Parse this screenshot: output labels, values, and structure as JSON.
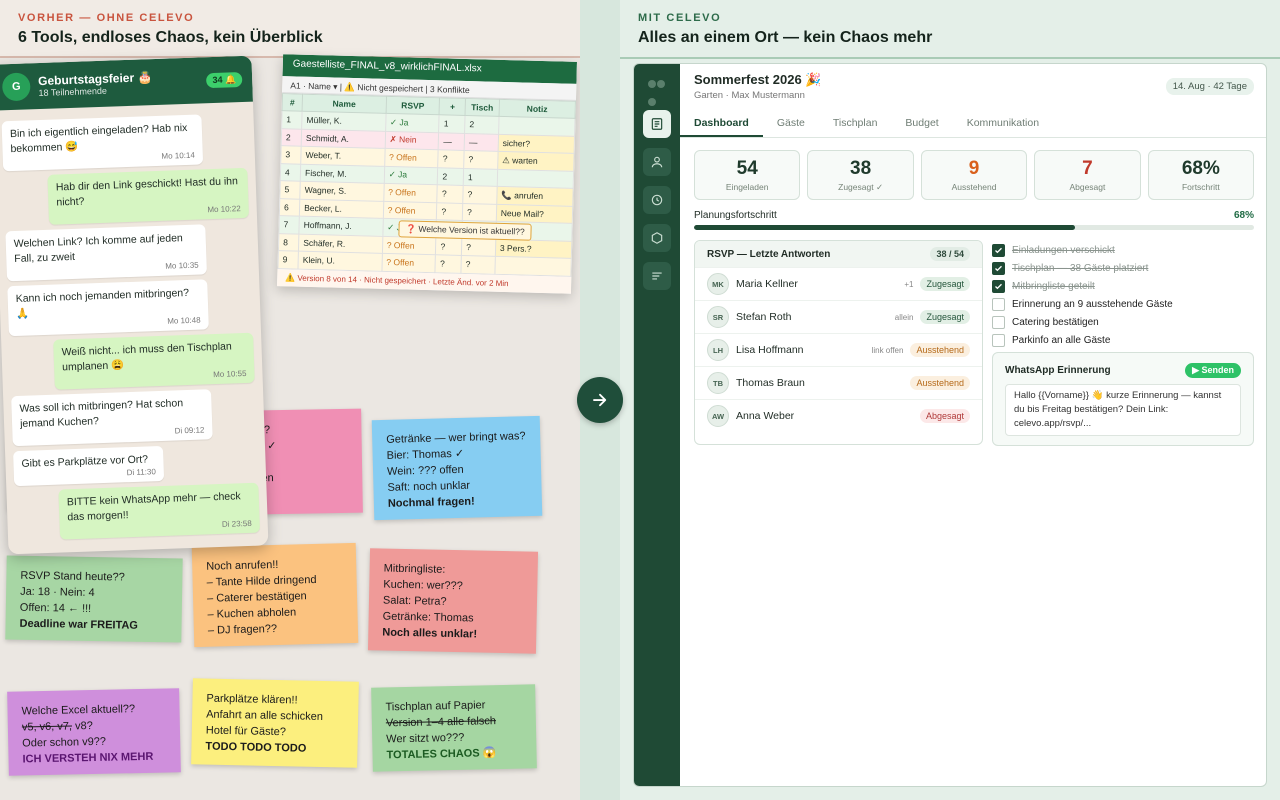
{
  "left": {
    "kicker": "VORHER — OHNE CELEVO",
    "headline": "6 Tools, endloses Chaos, kein Überblick",
    "whatsapp": {
      "avatar": "G",
      "title": "Geburtstagsfeier 🎂",
      "subtitle": "18 Teilnehmende",
      "badge": "34 🔔",
      "messages": [
        {
          "text": "Bin ich eigentlich eingeladen? Hab nix bekommen 😅",
          "time": "Mo 10:14"
        },
        {
          "text": "Hab dir den Link geschickt! Hast du ihn nicht?",
          "time": "Mo 10:22"
        },
        {
          "text": "Welchen Link? Ich komme auf jeden Fall, zu zweit",
          "time": "Mo 10:35"
        },
        {
          "text": "Kann ich noch jemanden mitbringen? 🙏",
          "time": "Mo 10:48"
        },
        {
          "text": "Weiß nicht... ich muss den Tischplan umplanen 😩",
          "time": "Mo 10:55"
        },
        {
          "text": "Was soll ich mitbringen? Hat schon jemand Kuchen?",
          "time": "Di 09:12"
        },
        {
          "text": "Gibt es Parkplätze vor Ort?",
          "time": "Di 11:30"
        },
        {
          "text": "BITTE kein WhatsApp mehr — check das morgen!!",
          "time": "Di 23:58"
        }
      ]
    },
    "excel": {
      "title": "Gaestelliste_FINAL_v8_wirklichFINAL.xlsx",
      "toolbar": "A1 · Name ▾ | ⚠️ Nicht gespeichert | 3 Konflikte",
      "headers": [
        "#",
        "Name",
        "RSVP",
        "+",
        "Tisch",
        "Notiz"
      ],
      "rows": [
        [
          "1",
          "Müller, K.",
          "✓ Ja",
          "1",
          "2",
          ""
        ],
        [
          "2",
          "Schmidt, A.",
          "✗ Nein",
          "—",
          "—",
          "sicher?"
        ],
        [
          "3",
          "Weber, T.",
          "? Offen",
          "?",
          "?",
          "⚠ warten"
        ],
        [
          "4",
          "Fischer, M.",
          "✓ Ja",
          "2",
          "1",
          ""
        ],
        [
          "5",
          "Wagner, S.",
          "? Offen",
          "?",
          "?",
          "📞 anrufen"
        ],
        [
          "6",
          "Becker, L.",
          "? Offen",
          "?",
          "?",
          "Neue Mail?"
        ],
        [
          "7",
          "Hoffmann, J.",
          "✓ J",
          "",
          "",
          ""
        ],
        [
          "8",
          "Schäfer, R.",
          "? Offen",
          "?",
          "?",
          "3 Pers.?"
        ],
        [
          "9",
          "Klein, U.",
          "? Offen",
          "?",
          "?",
          ""
        ]
      ],
      "popup": "❓ Welche Version ist aktuell??",
      "footer": "⚠️ Version 8 von 14 · Nicht gespeichert · Letzte Änd. vor 2 Min"
    },
    "notes": {
      "pink": [
        "and??",
        "320€ ✓",
        "❌",
        "h offen",
        "!!"
      ],
      "drinks": [
        "Getränke — wer bringt was?",
        "Bier: Thomas ✓",
        "Wein: ??? offen",
        "Saft: noch unklar",
        "Nochmal fragen!"
      ],
      "rsvp": [
        "RSVP Stand heute??",
        "Ja: 18 · Nein: 4",
        "Offen: 14 ← !!!",
        "Deadline war FREITAG"
      ],
      "calls": [
        "Noch anrufen!!",
        "– Tante Hilde dringend",
        "– Caterer bestätigen",
        "– Kuchen abholen",
        "– DJ fragen??"
      ],
      "mitbring": [
        "Mitbringliste:",
        "Kuchen: wer???",
        "Salat: Petra?",
        "Getränke: Thomas",
        "Noch alles unklar!"
      ],
      "excel": [
        "Welche Excel aktuell??",
        "v5, v6, v7,",
        " v8?",
        "Oder schon v9??",
        "ICH VERSTEH NIX MEHR"
      ],
      "park": [
        "Parkplätze klären!!",
        "Anfahrt an alle schicken",
        "Hotel für Gäste?",
        "TODO TODO TODO"
      ],
      "tisch": [
        "Tischplan auf Papier",
        "Version 1–4 alle falsch",
        "Wer sitzt wo???",
        "TOTALES CHAOS 😱"
      ]
    }
  },
  "right": {
    "kicker": "MIT CELEVO",
    "headline": "Alles an einem Ort — kein Chaos mehr",
    "app": {
      "sidebar_icons": [
        "dashboard-icon",
        "guest-icon",
        "clock-icon",
        "box-icon",
        "list-icon"
      ],
      "project_title": "Sommerfest 2026 🎉",
      "project_sub": "Garten · Max Mustermann",
      "project_date": "14. Aug · 42 Tage",
      "tabs": [
        "Dashboard",
        "Gäste",
        "Tischplan",
        "Budget",
        "Kommunikation"
      ],
      "stats": [
        {
          "value": "54",
          "label": "Eingeladen",
          "color": "#1f3a2c"
        },
        {
          "value": "38",
          "label": "Zugesagt ✓",
          "color": "#1f3a2c"
        },
        {
          "value": "9",
          "label": "Ausstehend",
          "color": "#d9601c"
        },
        {
          "value": "7",
          "label": "Abgesagt",
          "color": "#c0392b"
        },
        {
          "value": "68%",
          "label": "Fortschritt",
          "color": "#1f3a2c"
        }
      ],
      "progress_label": "Planungsfortschritt",
      "progress_pct_text": "68%",
      "progress_value": 0.68,
      "rsvp_title": "RSVP — Letzte Antworten",
      "rsvp_count": "38 / 54",
      "rsvp_rows": [
        {
          "initials": "MK",
          "name": "Maria Kellner",
          "extra": "+1",
          "status": "Zugesagt",
          "kind": "yes"
        },
        {
          "initials": "SR",
          "name": "Stefan Roth",
          "extra": "allein",
          "status": "Zugesagt",
          "kind": "yes"
        },
        {
          "initials": "LH",
          "name": "Lisa Hoffmann",
          "extra": "link offen",
          "status": "Ausstehend",
          "kind": "wait"
        },
        {
          "initials": "TB",
          "name": "Thomas Braun",
          "extra": "",
          "status": "Ausstehend",
          "kind": "wait"
        },
        {
          "initials": "AW",
          "name": "Anna Weber",
          "extra": "",
          "status": "Abgesagt",
          "kind": "no"
        }
      ],
      "checklist": [
        {
          "label": "Einladungen verschickt",
          "done": true
        },
        {
          "label": "Tischplan — 38 Gäste platziert",
          "done": true
        },
        {
          "label": "Mitbringliste geteilt",
          "done": true
        },
        {
          "label": "Erinnerung an 9 ausstehende Gäste",
          "done": false
        },
        {
          "label": "Catering bestätigen",
          "done": false
        },
        {
          "label": "Parkinfo an alle Gäste",
          "done": false
        }
      ],
      "whatsapp_title": "WhatsApp Erinnerung",
      "send_label": "▶ Senden",
      "whatsapp_text": "Hallo {{Vorname}} 👋 kurze Erinnerung — kannst du bis Freitag bestätigen? Dein Link: celevo.app/rsvp/..."
    }
  }
}
